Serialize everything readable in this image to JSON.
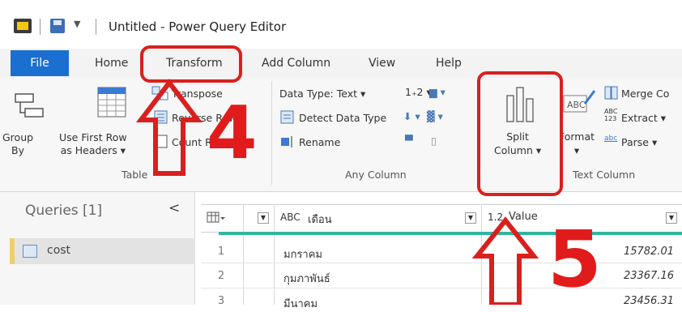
{
  "window": {
    "title": "Untitled - Power Query Editor"
  },
  "tabs": [
    "File",
    "Home",
    "Transform",
    "Add Column",
    "View",
    "Help"
  ],
  "ribbon": {
    "table_group": {
      "label": "Table",
      "group_by": [
        "Group",
        "By"
      ],
      "use_first_row": [
        "Use First Row",
        "as Headers ▾"
      ],
      "transpose": "Transpose",
      "reverse_rows": "Reverse Rows",
      "count_rows": "Count Rows"
    },
    "any_column_group": {
      "label": "Any Column",
      "data_type": "Data Type: Text ▾",
      "detect_data_type": "Detect Data Type",
      "rename": "Rename"
    },
    "text_column_group": {
      "label": "Text Column",
      "split_column": [
        "Split",
        "Column ▾"
      ],
      "format": "Format",
      "merge_columns": "Merge Co",
      "extract": "Extract ▾",
      "extract_icon": [
        "ABC",
        "123"
      ],
      "parse": "Parse ▾",
      "parse_icon": "abc"
    }
  },
  "queries": {
    "title": "Queries [1]",
    "collapse": "<",
    "items": [
      {
        "name": "cost"
      }
    ]
  },
  "grid": {
    "columns": [
      {
        "type": "ABC",
        "name": "เดือน"
      },
      {
        "type": "1.2",
        "name": "Value"
      }
    ],
    "rows": [
      {
        "n": "1",
        "month": "มกราคม",
        "value": "15782.01"
      },
      {
        "n": "2",
        "month": "กุมภาพันธ์",
        "value": "23367.16"
      },
      {
        "n": "3",
        "month": "มีนาคม",
        "value": "23456.31"
      }
    ]
  },
  "annotations": {
    "step4": "4",
    "step5": "5"
  },
  "colors": {
    "accent": "#1a6fd0",
    "annotation_red": "#d9201e",
    "header_line": "#30b6a0"
  }
}
